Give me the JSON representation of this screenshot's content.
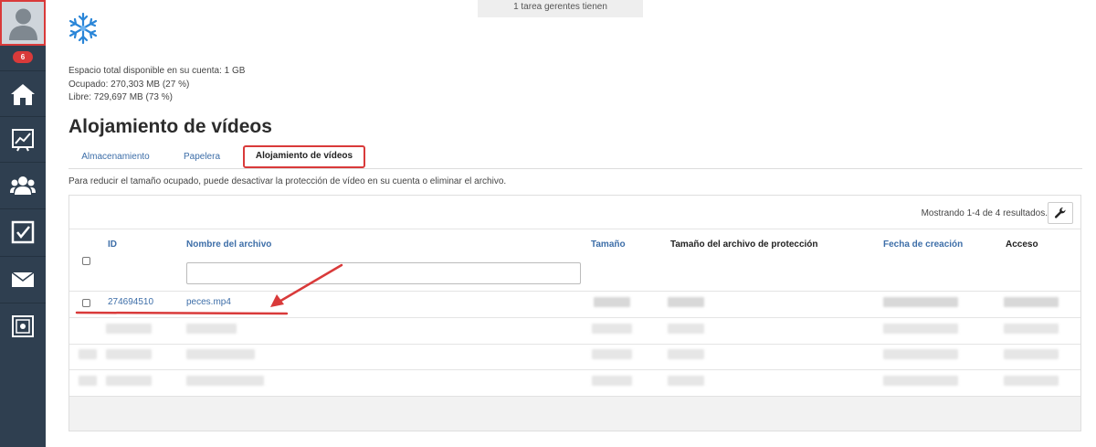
{
  "sidebar": {
    "badge_count": "6",
    "items": [
      {
        "name": "home",
        "icon": "home-icon"
      },
      {
        "name": "stats",
        "icon": "chart-icon"
      },
      {
        "name": "contacts",
        "icon": "users-icon"
      },
      {
        "name": "tasks",
        "icon": "checkbox-icon"
      },
      {
        "name": "mail",
        "icon": "envelope-icon"
      },
      {
        "name": "storage",
        "icon": "safe-icon"
      }
    ]
  },
  "notice": {
    "text": "1 tarea gerentes tienen"
  },
  "storage": {
    "total": "Espacio total disponible en su cuenta: 1 GB",
    "used": "Ocupado: 270,303 MB (27 %)",
    "free": "Libre: 729,697 MB (73 %)"
  },
  "page_title": "Alojamiento de vídeos",
  "tabs": [
    {
      "label": "Almacenamiento",
      "active": false
    },
    {
      "label": "Papelera",
      "active": false
    },
    {
      "label": "Alojamiento de vídeos",
      "active": true
    }
  ],
  "hint": "Para reducir el tamaño ocupado, puede desactivar la protección de vídeo en su cuenta o eliminar el archivo.",
  "table": {
    "showing": "Mostrando 1-4 de 4 resultados.",
    "columns": [
      "ID",
      "Nombre del archivo",
      "Tamaño",
      "Tamaño del archivo de protección",
      "Fecha de creación",
      "Acceso"
    ],
    "filter_value": "",
    "rows": [
      {
        "id": "274694510",
        "name": "peces.mp4"
      }
    ]
  },
  "colors": {
    "sidebar": "#2f3f50",
    "accent_red": "#d93a3a",
    "link": "#3d6ea8"
  }
}
